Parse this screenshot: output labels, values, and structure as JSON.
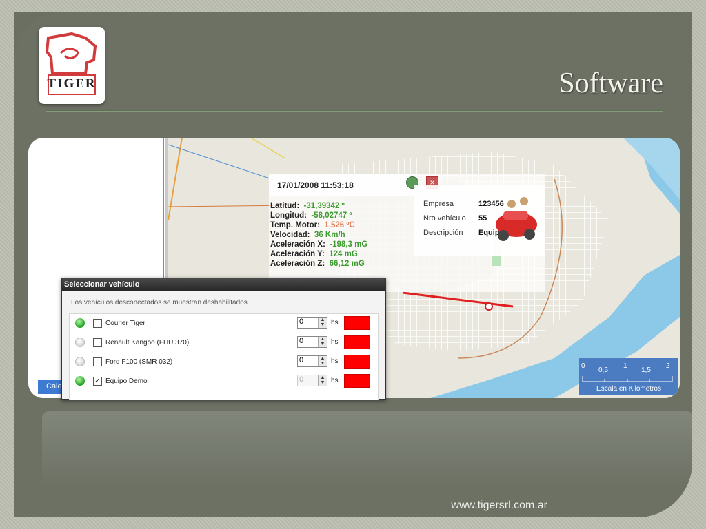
{
  "slide": {
    "logo_text": "TIGER",
    "title": "Software",
    "footer": "www.tigersrl.com.ar"
  },
  "app": {
    "calendar_button": "Cale",
    "info": {
      "timestamp": "17/01/2008 11:53:18",
      "telemetry": [
        {
          "label": "Latitud:",
          "value": "-31,39342 º"
        },
        {
          "label": "Longitud:",
          "value": "-58,02747 º"
        },
        {
          "label": "Temp. Motor:",
          "value": "1,526 ºC"
        },
        {
          "label": "Velocidad:",
          "value": "36 Km/h"
        },
        {
          "label": "Aceleración X:",
          "value": "-198,3 mG"
        },
        {
          "label": "Aceleración Y:",
          "value": "124 mG"
        },
        {
          "label": "Aceleración Z:",
          "value": "66,12 mG"
        }
      ],
      "details": [
        {
          "label": "Empresa",
          "value": "123456"
        },
        {
          "label": "Nro vehículo",
          "value": "55"
        },
        {
          "label": "Descripción",
          "value": "Equipo Demo"
        }
      ]
    },
    "scale": {
      "ticks": [
        "0",
        "0,5",
        "1",
        "1,5",
        "2"
      ],
      "label": "Escala en Kilometros"
    },
    "dialog": {
      "title": "Seleccionar vehículo",
      "note": "Los vehículos desconectados se muestran deshabilitados",
      "unit": "hs",
      "vehicles": [
        {
          "name": "Courier Tiger",
          "online": true,
          "checked": false,
          "hours": "0"
        },
        {
          "name": "Renault Kangoo (FHU 370)",
          "online": false,
          "checked": false,
          "hours": "0"
        },
        {
          "name": "Ford F100 (SMR 032)",
          "online": false,
          "checked": false,
          "hours": "0"
        },
        {
          "name": "Equipo Demo",
          "online": true,
          "checked": true,
          "hours": "0"
        }
      ]
    }
  },
  "colors": {
    "slide_bg": "#6c7164",
    "map_land": "#e9e7dd",
    "river": "#8cc8e8",
    "value_green": "#3c9b2f",
    "vehicle_color": "#ff0000"
  }
}
